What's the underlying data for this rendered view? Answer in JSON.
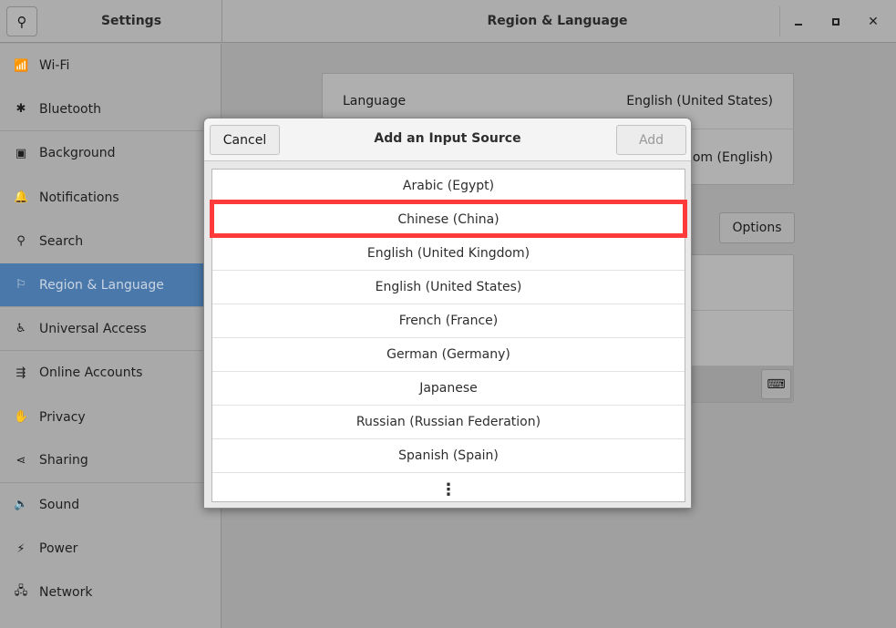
{
  "header": {
    "title": "Settings",
    "panel_title": "Region & Language"
  },
  "sidebar": {
    "items": [
      {
        "label": "Wi-Fi",
        "icon": "wifi-icon",
        "glyph": "📶"
      },
      {
        "label": "Bluetooth",
        "icon": "bluetooth-icon",
        "glyph": "✱"
      },
      {
        "label": "Background",
        "icon": "background-icon",
        "glyph": "▣"
      },
      {
        "label": "Notifications",
        "icon": "bell-icon",
        "glyph": "🔔"
      },
      {
        "label": "Search",
        "icon": "search-icon",
        "glyph": "⚲"
      },
      {
        "label": "Region & Language",
        "icon": "flag-icon",
        "glyph": "⚐",
        "selected": true
      },
      {
        "label": "Universal Access",
        "icon": "accessibility-icon",
        "glyph": "♿"
      },
      {
        "label": "Online Accounts",
        "icon": "online-accounts-icon",
        "glyph": "⇶"
      },
      {
        "label": "Privacy",
        "icon": "hand-icon",
        "glyph": "✋"
      },
      {
        "label": "Sharing",
        "icon": "share-icon",
        "glyph": "⋖"
      },
      {
        "label": "Sound",
        "icon": "speaker-icon",
        "glyph": "🔈"
      },
      {
        "label": "Power",
        "icon": "power-icon",
        "glyph": "⚡"
      },
      {
        "label": "Network",
        "icon": "network-icon",
        "glyph": "🖧"
      }
    ]
  },
  "main": {
    "language_label": "Language",
    "language_value": "English (United States)",
    "formats_value": "dom (English)",
    "options_label": "Options"
  },
  "dialog": {
    "title": "Add an Input Source",
    "cancel_label": "Cancel",
    "add_label": "Add",
    "more": "⋮",
    "items": [
      "Arabic (Egypt)",
      "Chinese (China)",
      "English (United Kingdom)",
      "English (United States)",
      "French (France)",
      "German (Germany)",
      "Japanese",
      "Russian (Russian Federation)",
      "Spanish (Spain)"
    ],
    "highlighted": "Chinese (China)",
    "highlight_color": "#ff3a3a"
  }
}
